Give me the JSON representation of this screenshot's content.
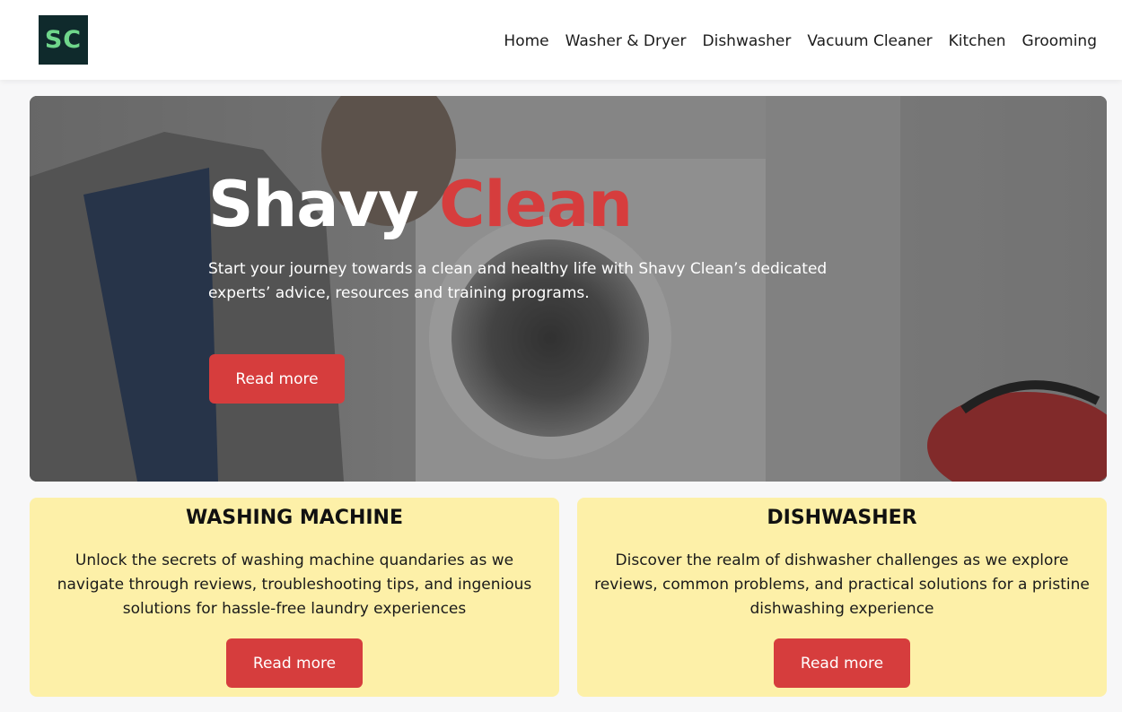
{
  "logo": {
    "text": "SC"
  },
  "nav": {
    "items": [
      {
        "label": "Home"
      },
      {
        "label": "Washer & Dryer"
      },
      {
        "label": "Dishwasher"
      },
      {
        "label": "Vacuum Cleaner"
      },
      {
        "label": "Kitchen"
      },
      {
        "label": "Grooming"
      }
    ]
  },
  "hero": {
    "title_part1": "Shavy",
    "title_part2": "Clean",
    "text": "Start your journey towards a clean and healthy life with Shavy Clean’s dedicated experts’ advice, resources and training programs.",
    "button_label": "Read more"
  },
  "cards": [
    {
      "title": "WASHING MACHINE",
      "text": "Unlock the secrets of washing machine quandaries as we navigate through reviews, troubleshooting tips, and ingenious solutions for hassle-free laundry experiences",
      "button_label": "Read more"
    },
    {
      "title": "DISHWASHER",
      "text": "Discover the realm of dishwasher challenges as we explore reviews, common problems, and practical solutions for a pristine dishwashing experience",
      "button_label": "Read more"
    }
  ],
  "colors": {
    "accent": "#d63d3d",
    "logo_bg": "#0f2a2c",
    "logo_text": "#6fd68b",
    "card_bg": "#fdf0a8"
  }
}
